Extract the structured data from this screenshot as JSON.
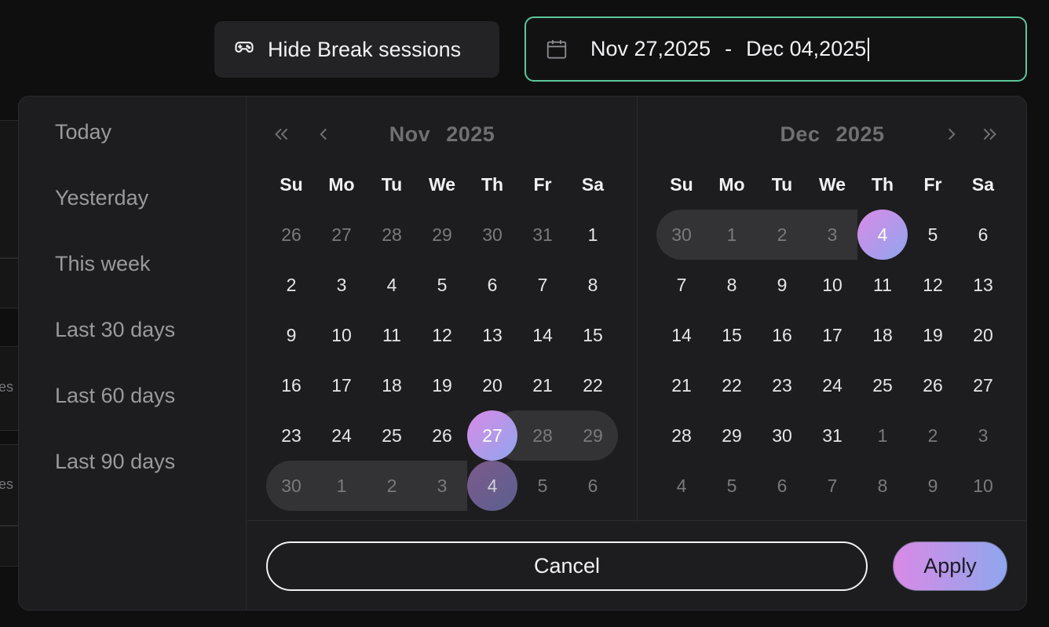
{
  "background": {
    "snippet_1": "es",
    "snippet_2": "es"
  },
  "toolbar": {
    "hide_break_label": "Hide Break sessions",
    "hide_break_icon": "gamepad-icon"
  },
  "date_range": {
    "icon": "calendar-icon",
    "start": "Nov 27,2025",
    "separator": "-",
    "end": "Dec 04,2025"
  },
  "presets": [
    "Today",
    "Yesterday",
    "This week",
    "Last 30 days",
    "Last 60 days",
    "Last 90 days"
  ],
  "weekdays": [
    "Su",
    "Mo",
    "Tu",
    "We",
    "Th",
    "Fr",
    "Sa"
  ],
  "calendars": [
    {
      "month": "Nov",
      "year": "2025",
      "weeks": [
        [
          {
            "d": "26",
            "s": "muted"
          },
          {
            "d": "27",
            "s": "muted"
          },
          {
            "d": "28",
            "s": "muted"
          },
          {
            "d": "29",
            "s": "muted"
          },
          {
            "d": "30",
            "s": "muted"
          },
          {
            "d": "31",
            "s": "muted"
          },
          {
            "d": "1",
            "s": ""
          }
        ],
        [
          {
            "d": "2",
            "s": ""
          },
          {
            "d": "3",
            "s": ""
          },
          {
            "d": "4",
            "s": ""
          },
          {
            "d": "5",
            "s": ""
          },
          {
            "d": "6",
            "s": ""
          },
          {
            "d": "7",
            "s": ""
          },
          {
            "d": "8",
            "s": ""
          }
        ],
        [
          {
            "d": "9",
            "s": ""
          },
          {
            "d": "10",
            "s": ""
          },
          {
            "d": "11",
            "s": ""
          },
          {
            "d": "12",
            "s": ""
          },
          {
            "d": "13",
            "s": ""
          },
          {
            "d": "14",
            "s": ""
          },
          {
            "d": "15",
            "s": ""
          }
        ],
        [
          {
            "d": "16",
            "s": ""
          },
          {
            "d": "17",
            "s": ""
          },
          {
            "d": "18",
            "s": ""
          },
          {
            "d": "19",
            "s": ""
          },
          {
            "d": "20",
            "s": ""
          },
          {
            "d": "21",
            "s": ""
          },
          {
            "d": "22",
            "s": ""
          }
        ],
        [
          {
            "d": "23",
            "s": ""
          },
          {
            "d": "24",
            "s": ""
          },
          {
            "d": "25",
            "s": ""
          },
          {
            "d": "26",
            "s": ""
          },
          {
            "d": "27",
            "s": "sel joinright"
          },
          {
            "d": "28",
            "s": "muted inrange"
          },
          {
            "d": "29",
            "s": "muted inrange end"
          }
        ],
        [
          {
            "d": "30",
            "s": "muted inrange start"
          },
          {
            "d": "1",
            "s": "muted inrange"
          },
          {
            "d": "2",
            "s": "muted inrange"
          },
          {
            "d": "3",
            "s": "muted inrange"
          },
          {
            "d": "4",
            "s": "sel dim"
          },
          {
            "d": "5",
            "s": "muted"
          },
          {
            "d": "6",
            "s": "muted"
          }
        ]
      ]
    },
    {
      "month": "Dec",
      "year": "2025",
      "weeks": [
        [
          {
            "d": "30",
            "s": "muted inrange start"
          },
          {
            "d": "1",
            "s": "muted inrange"
          },
          {
            "d": "2",
            "s": "muted inrange"
          },
          {
            "d": "3",
            "s": "muted inrange"
          },
          {
            "d": "4",
            "s": "sel"
          },
          {
            "d": "5",
            "s": ""
          },
          {
            "d": "6",
            "s": ""
          }
        ],
        [
          {
            "d": "7",
            "s": ""
          },
          {
            "d": "8",
            "s": ""
          },
          {
            "d": "9",
            "s": ""
          },
          {
            "d": "10",
            "s": ""
          },
          {
            "d": "11",
            "s": ""
          },
          {
            "d": "12",
            "s": ""
          },
          {
            "d": "13",
            "s": ""
          }
        ],
        [
          {
            "d": "14",
            "s": ""
          },
          {
            "d": "15",
            "s": ""
          },
          {
            "d": "16",
            "s": ""
          },
          {
            "d": "17",
            "s": ""
          },
          {
            "d": "18",
            "s": ""
          },
          {
            "d": "19",
            "s": ""
          },
          {
            "d": "20",
            "s": ""
          }
        ],
        [
          {
            "d": "21",
            "s": ""
          },
          {
            "d": "22",
            "s": ""
          },
          {
            "d": "23",
            "s": ""
          },
          {
            "d": "24",
            "s": ""
          },
          {
            "d": "25",
            "s": ""
          },
          {
            "d": "26",
            "s": ""
          },
          {
            "d": "27",
            "s": ""
          }
        ],
        [
          {
            "d": "28",
            "s": ""
          },
          {
            "d": "29",
            "s": ""
          },
          {
            "d": "30",
            "s": ""
          },
          {
            "d": "31",
            "s": ""
          },
          {
            "d": "1",
            "s": "muted"
          },
          {
            "d": "2",
            "s": "muted"
          },
          {
            "d": "3",
            "s": "muted"
          }
        ],
        [
          {
            "d": "4",
            "s": "muted"
          },
          {
            "d": "5",
            "s": "muted"
          },
          {
            "d": "6",
            "s": "muted"
          },
          {
            "d": "7",
            "s": "muted"
          },
          {
            "d": "8",
            "s": "muted"
          },
          {
            "d": "9",
            "s": "muted"
          },
          {
            "d": "10",
            "s": "muted"
          }
        ]
      ]
    }
  ],
  "nav": {
    "prev_year": "«",
    "prev_month": "‹",
    "next_month": "›",
    "next_year": "»"
  },
  "buttons": {
    "cancel": "Cancel",
    "apply": "Apply"
  },
  "colors": {
    "accent_border": "#5cc79a",
    "selection_start": "#d98ae6",
    "selection_end": "#8fa6ee",
    "range_fill": "#333335"
  }
}
